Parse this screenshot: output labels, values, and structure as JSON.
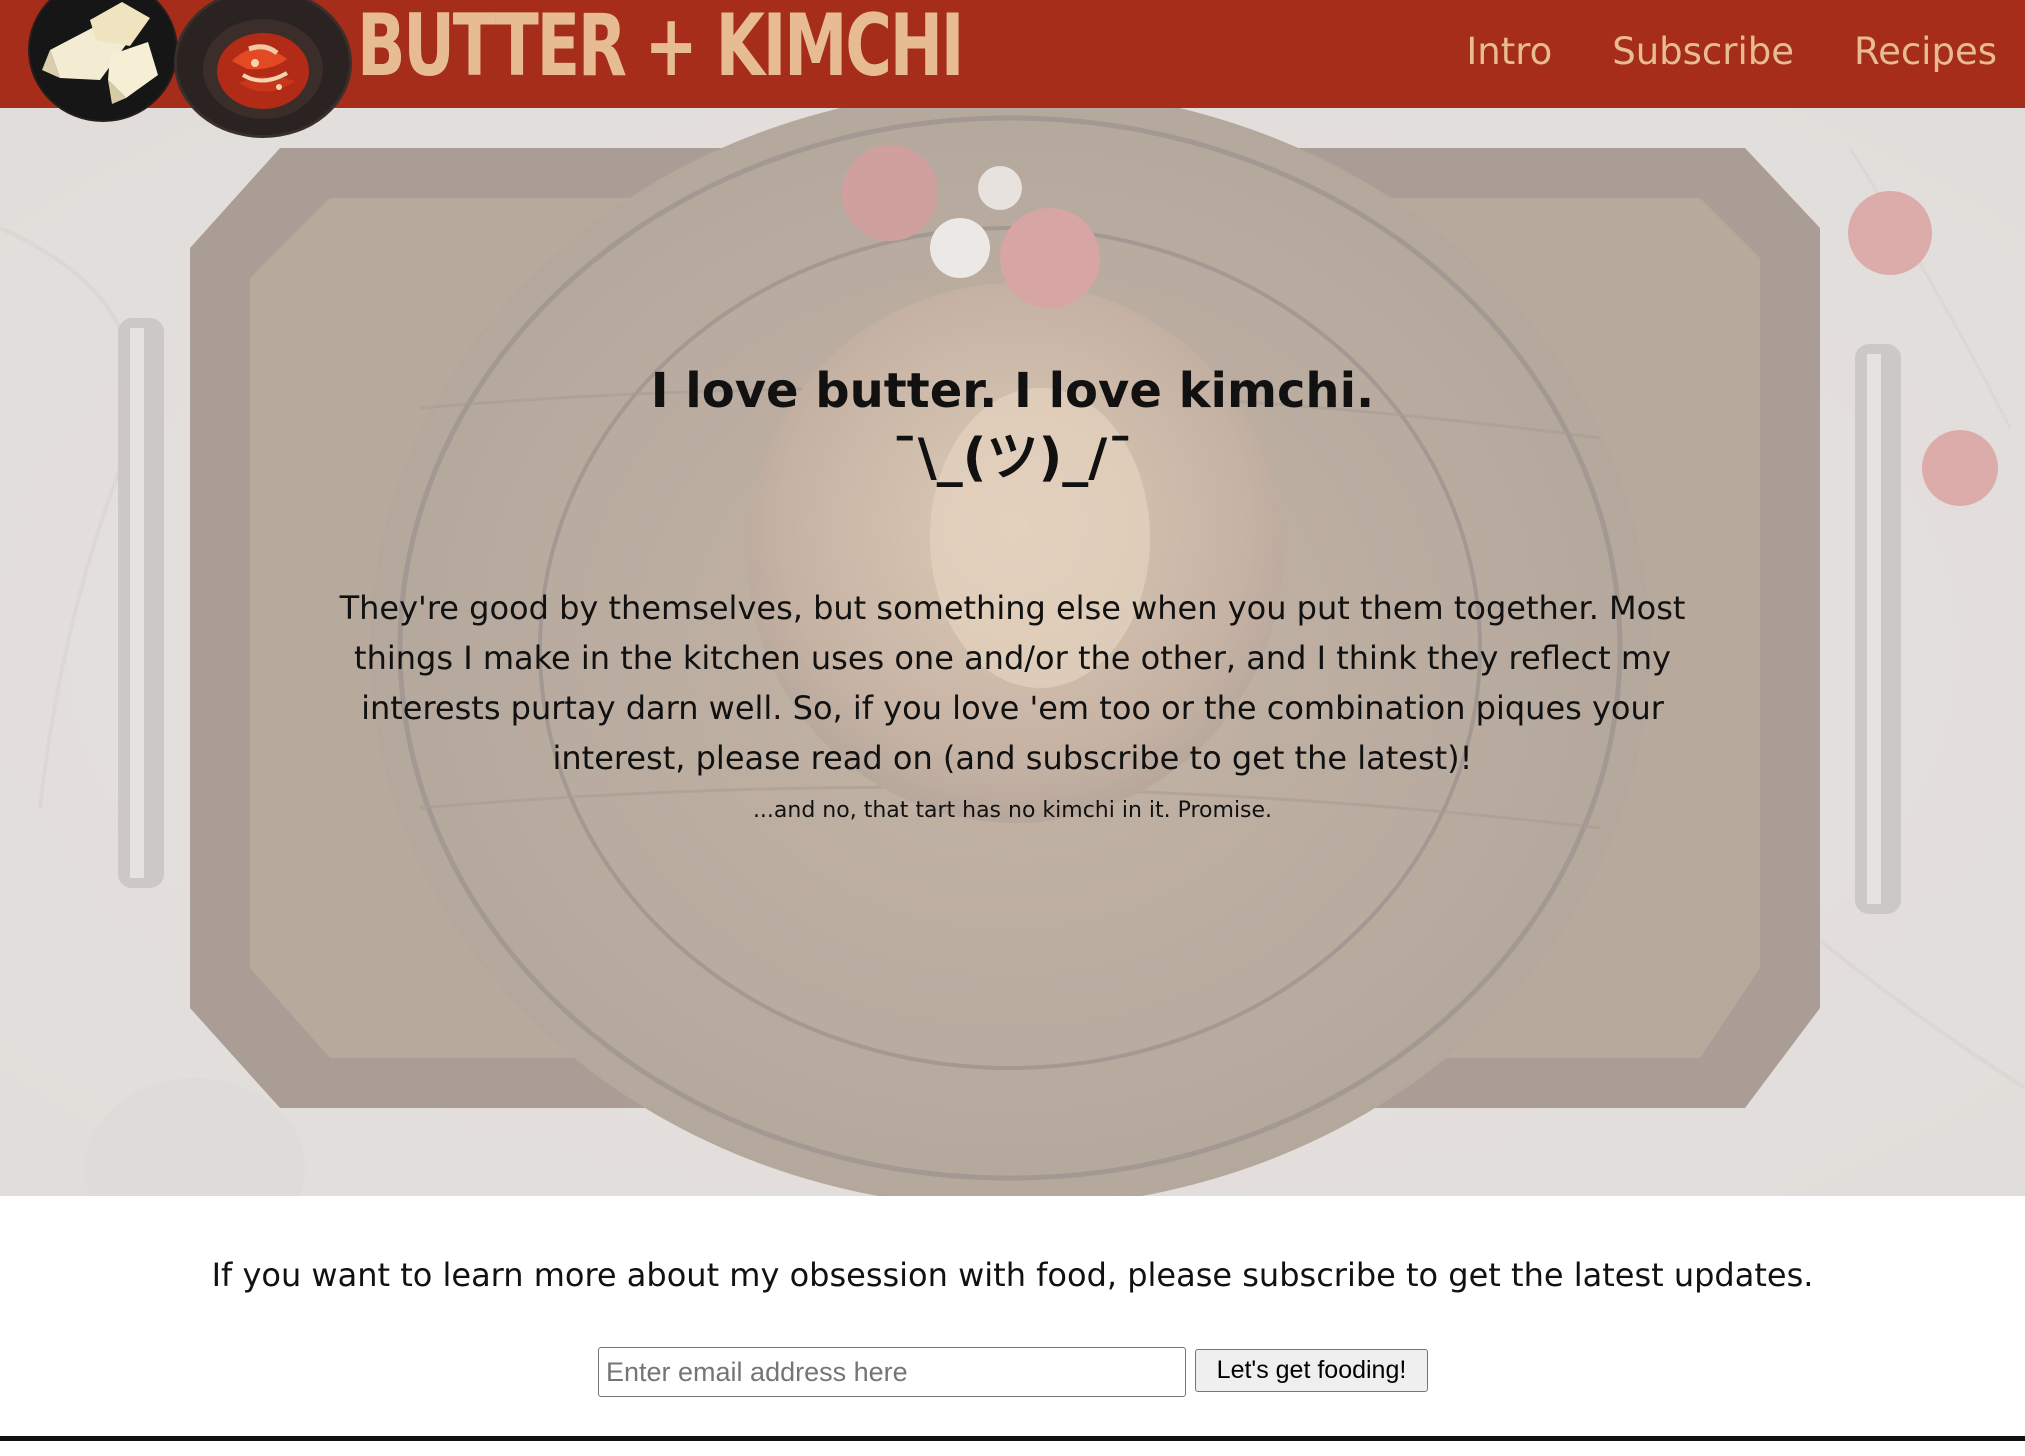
{
  "header": {
    "brand_title": "BUTTER + KIMCHI",
    "background_color": "#a52d1a",
    "accent_color": "#e8bc93",
    "logos": [
      {
        "icon": "butter-photo-icon"
      },
      {
        "icon": "kimchi-photo-icon"
      }
    ],
    "nav": [
      {
        "label": "Intro"
      },
      {
        "label": "Subscribe"
      },
      {
        "label": "Recipes"
      }
    ]
  },
  "hero": {
    "heading": "I love butter. I love kimchi.",
    "shrug": "¯\\_(ツ)_/¯",
    "body": "They're good by themselves, but something else when you put them together. Most things I make in the kitchen uses one and/or the other, and I think they reflect my interests purtay darn well. So, if you love 'em too or the combination piques your interest, please read on (and subscribe to get the latest)!",
    "footnote": "...and no, that tart has no kimchi in it. Promise.",
    "background_icon": "tart-on-wooden-tray-photo"
  },
  "subscribe": {
    "text": "If you want to learn more about my obsession with food, please subscribe to get the latest updates.",
    "email_placeholder": "Enter email address here",
    "email_value": "",
    "button_label": "Let's get fooding!"
  }
}
